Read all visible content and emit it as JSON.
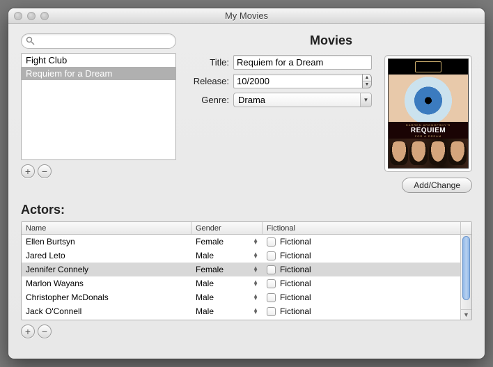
{
  "window": {
    "title": "My Movies"
  },
  "search": {
    "placeholder": ""
  },
  "movie_list": {
    "items": [
      {
        "label": "Fight Club",
        "selected": false
      },
      {
        "label": "Requiem for a Dream",
        "selected": true
      }
    ]
  },
  "heading_movies": "Movies",
  "form": {
    "title_label": "Title:",
    "title_value": "Requiem for a Dream",
    "release_label": "Release:",
    "release_value": "10/2000",
    "genre_label": "Genre:",
    "genre_value": "Drama"
  },
  "poster": {
    "tagline": "DARREN ARONOFSKY'S",
    "title": "REQUIEM",
    "subtitle": "FOR A DREAM"
  },
  "buttons": {
    "add_change": "Add/Change"
  },
  "heading_actors": "Actors:",
  "actors": {
    "columns": {
      "name": "Name",
      "gender": "Gender",
      "fictional": "Fictional"
    },
    "fictional_label": "Fictional",
    "rows": [
      {
        "name": "Ellen Burtsyn",
        "gender": "Female",
        "fictional": false,
        "selected": false
      },
      {
        "name": "Jared Leto",
        "gender": "Male",
        "fictional": false,
        "selected": false
      },
      {
        "name": "Jennifer Connely",
        "gender": "Female",
        "fictional": false,
        "selected": true
      },
      {
        "name": "Marlon Wayans",
        "gender": "Male",
        "fictional": false,
        "selected": false
      },
      {
        "name": "Christopher McDonals",
        "gender": "Male",
        "fictional": false,
        "selected": false
      },
      {
        "name": "Jack O'Connell",
        "gender": "Male",
        "fictional": false,
        "selected": false
      }
    ]
  }
}
